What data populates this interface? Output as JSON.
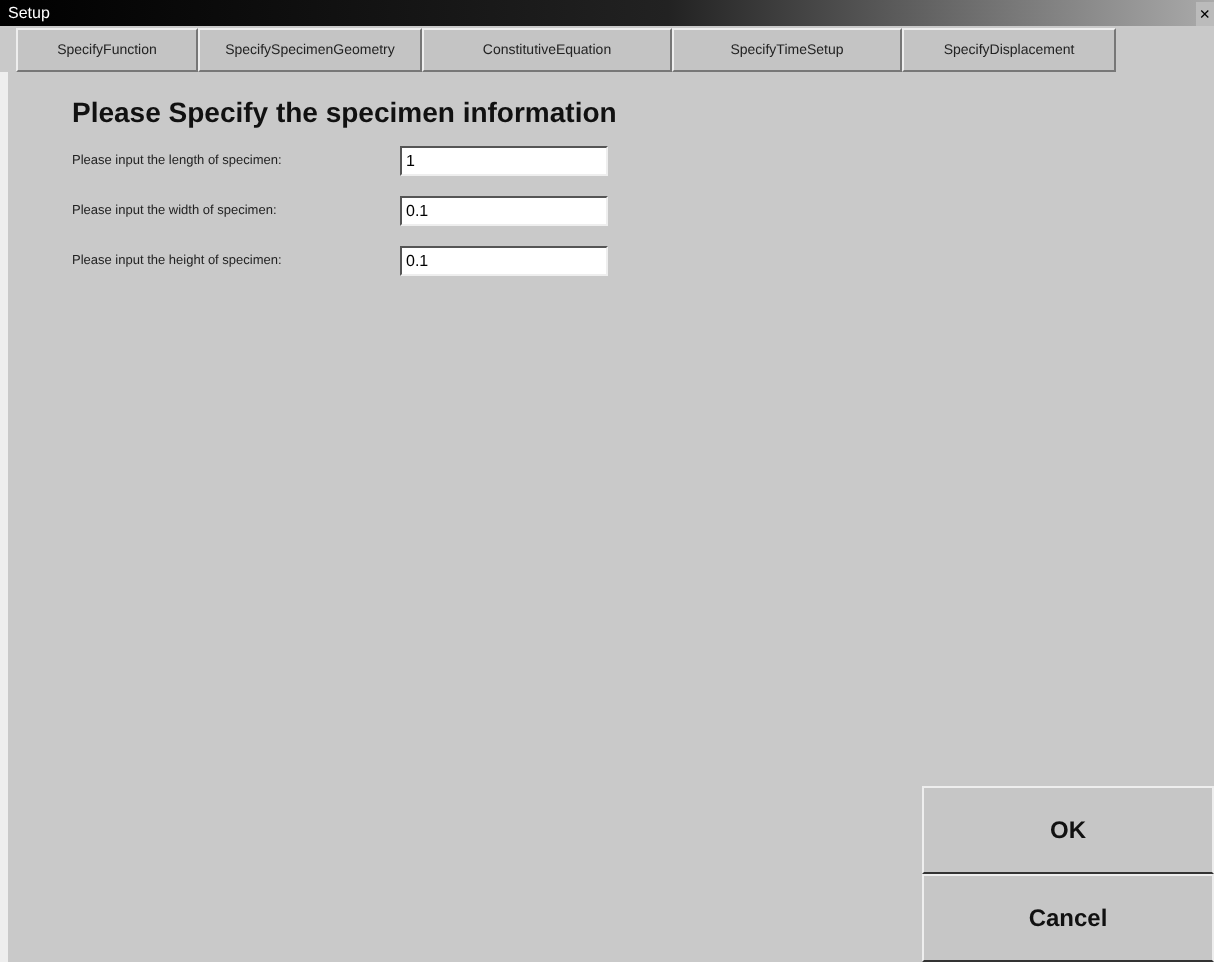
{
  "window": {
    "title": "Setup",
    "close": "×"
  },
  "tabs": [
    {
      "label": "SpecifyFunction",
      "selected": false
    },
    {
      "label": "SpecifySpecimenGeometry",
      "selected": false
    },
    {
      "label": "ConstitutiveEquation",
      "selected": false
    },
    {
      "label": "SpecifyTimeSetup",
      "selected": false
    },
    {
      "label": "SpecifyDisplacement",
      "selected": false
    }
  ],
  "heading": "Please Specify the specimen information",
  "fields": [
    {
      "label": "Please input the length of specimen:",
      "value": "1"
    },
    {
      "label": "Please input the width of specimen:",
      "value": "0.1"
    },
    {
      "label": "Please input the height of specimen:",
      "value": "0.1"
    }
  ],
  "buttons": [
    "OK",
    "Cancel"
  ]
}
